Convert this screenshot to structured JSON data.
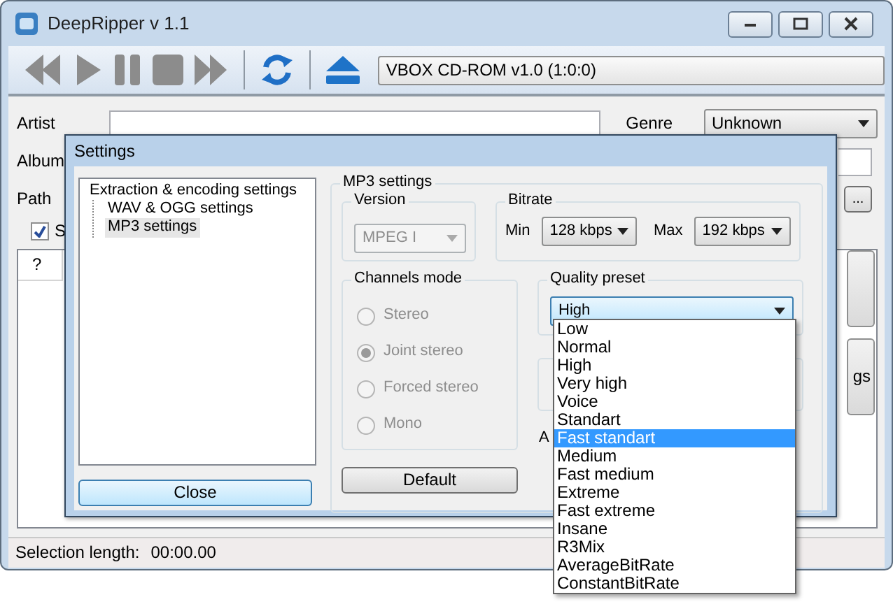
{
  "window": {
    "title": "DeepRipper v 1.1"
  },
  "toolbar": {
    "drive": "VBOX CD-ROM v1.0 (1:0:0)"
  },
  "fields": [
    {
      "label": "Artist"
    },
    {
      "label": "Album"
    },
    {
      "label": "Path"
    }
  ],
  "genre": {
    "label": "Genre",
    "value": "Unknown"
  },
  "browse_button": "...",
  "checkbox": {
    "label": "S",
    "checked": true
  },
  "track_list": {
    "columns": [
      "?"
    ]
  },
  "side_button": "gs",
  "status_bar": {
    "label": "Selection length:",
    "value": "00:00.00"
  },
  "settings": {
    "title": "Settings",
    "tree": [
      {
        "label": "Extraction & encoding settings",
        "selected": false,
        "children": [
          {
            "label": "WAV & OGG settings",
            "selected": false
          },
          {
            "label": "MP3 settings",
            "selected": true
          }
        ]
      }
    ],
    "close_button": "Close",
    "panel_title": "MP3 settings",
    "version": {
      "label": "Version",
      "value": "MPEG I",
      "disabled": true
    },
    "bitrate": {
      "label": "Bitrate",
      "min_label": "Min",
      "min": "128 kbps",
      "max_label": "Max",
      "max": "192 kbps"
    },
    "channels": {
      "label": "Channels mode",
      "disabled": true,
      "options": [
        {
          "label": "Stereo",
          "selected": false
        },
        {
          "label": "Joint stereo",
          "selected": true
        },
        {
          "label": "Forced stereo",
          "selected": false
        },
        {
          "label": "Mono",
          "selected": false
        }
      ]
    },
    "quality": {
      "label": "Quality preset",
      "value": "High",
      "expanded": true,
      "options": [
        {
          "label": "Low",
          "highlighted": false
        },
        {
          "label": "Normal",
          "highlighted": false
        },
        {
          "label": "High",
          "highlighted": false
        },
        {
          "label": "Very high",
          "highlighted": false
        },
        {
          "label": "Voice",
          "highlighted": false
        },
        {
          "label": "Standart",
          "highlighted": false
        },
        {
          "label": "Fast standart",
          "highlighted": true
        },
        {
          "label": "Medium",
          "highlighted": false
        },
        {
          "label": "Fast medium",
          "highlighted": false
        },
        {
          "label": "Extreme",
          "highlighted": false
        },
        {
          "label": "Fast extreme",
          "highlighted": false
        },
        {
          "label": "Insane",
          "highlighted": false
        },
        {
          "label": "R3Mix",
          "highlighted": false
        },
        {
          "label": "AverageBitRate",
          "highlighted": false
        },
        {
          "label": "ConstantBitRate",
          "highlighted": false
        }
      ]
    },
    "hidden_label": "A",
    "default_button": "Default"
  }
}
